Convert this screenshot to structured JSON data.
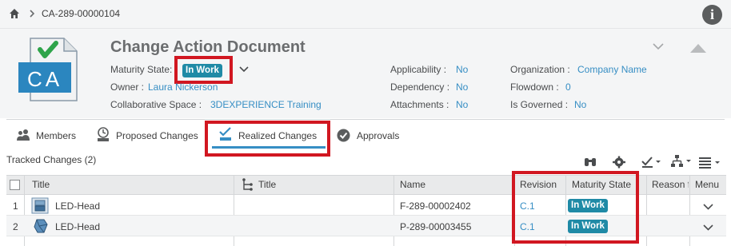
{
  "breadcrumb": {
    "path": "CA-289-00000104"
  },
  "header": {
    "title": "Change Action Document",
    "maturity_label": "Maturity State:",
    "maturity_value": "In Work",
    "owner_label": "Owner : ",
    "owner_value": "Laura Nickerson",
    "space_label": "Collaborative Space : ",
    "space_value": "3DEXPERIENCE Training",
    "applicability_label": "Applicability : ",
    "applicability_value": "No",
    "dependency_label": "Dependency : ",
    "dependency_value": "No",
    "attachments_label": "Attachments : ",
    "attachments_value": "No",
    "organization_label": "Organization : ",
    "organization_value": "Company Name",
    "flowdown_label": "Flowdown : ",
    "flowdown_value": "0",
    "governed_label": "Is Governed : ",
    "governed_value": "No",
    "icon_text": "CA"
  },
  "tabs": [
    {
      "label": "Members",
      "icon": "members-icon"
    },
    {
      "label": "Proposed Changes",
      "icon": "proposed-changes-icon"
    },
    {
      "label": "Realized Changes",
      "icon": "realized-changes-icon",
      "active": true
    },
    {
      "label": "Approvals",
      "icon": "approvals-icon"
    }
  ],
  "tracked": {
    "label": "Tracked Changes (2)"
  },
  "table": {
    "headers": [
      "Title",
      "Title",
      "Name",
      "Revision",
      "Maturity State",
      "Reason f",
      "Menu"
    ],
    "rows": [
      {
        "num": "1",
        "title": "LED-Head",
        "name": "F-289-00002402",
        "revision": "C.1",
        "state": "In Work"
      },
      {
        "num": "2",
        "title": "LED-Head",
        "name": "P-289-00003455",
        "revision": "C.1",
        "state": "In Work"
      }
    ]
  },
  "colors": {
    "accent": "#368ec4",
    "badge": "#1f8aa6",
    "highlight": "#d11721"
  }
}
